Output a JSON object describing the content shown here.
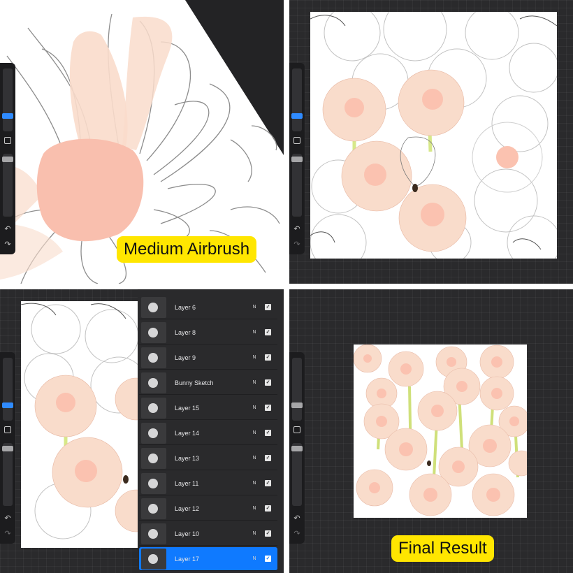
{
  "app": {
    "accent_color": "#0f7aff",
    "label_bg_color": "#ffe600",
    "petal_color": "#f9d7c5",
    "center_color": "#fbc2b0",
    "stem_color": "#cfe07a"
  },
  "panels": {
    "top_left": {
      "label": "Medium Airbrush"
    },
    "bottom_right": {
      "label": "Final Result"
    }
  },
  "sidebar": {
    "icons": [
      "modify-square-icon",
      "undo-icon",
      "redo-icon"
    ]
  },
  "layers": [
    {
      "name": "Layer 6",
      "blend": "N",
      "visible": true,
      "selected": false
    },
    {
      "name": "Layer 8",
      "blend": "N",
      "visible": true,
      "selected": false
    },
    {
      "name": "Layer 9",
      "blend": "N",
      "visible": true,
      "selected": false
    },
    {
      "name": "Bunny Sketch",
      "blend": "N",
      "visible": true,
      "selected": false
    },
    {
      "name": "Layer 15",
      "blend": "N",
      "visible": true,
      "selected": false
    },
    {
      "name": "Layer 14",
      "blend": "N",
      "visible": true,
      "selected": false
    },
    {
      "name": "Layer 13",
      "blend": "N",
      "visible": true,
      "selected": false
    },
    {
      "name": "Layer 11",
      "blend": "N",
      "visible": true,
      "selected": false
    },
    {
      "name": "Layer 12",
      "blend": "N",
      "visible": true,
      "selected": false
    },
    {
      "name": "Layer 10",
      "blend": "N",
      "visible": true,
      "selected": false
    },
    {
      "name": "Layer 17",
      "blend": "N",
      "visible": true,
      "selected": true
    }
  ]
}
